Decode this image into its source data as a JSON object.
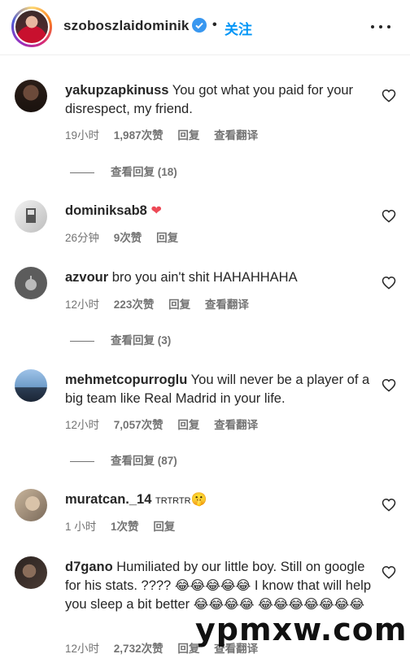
{
  "header": {
    "username": "szoboszlaidominik",
    "dot": "•",
    "follow_label": "关注"
  },
  "comments": [
    {
      "username": "yakupzapkinuss",
      "text": "You got what you paid for your disrespect, my friend.",
      "time": "19小时",
      "likes": "1,987次赞",
      "reply_label": "回复",
      "translate_label": "查看翻译",
      "view_replies": "查看回复 (18)"
    },
    {
      "username": "dominiksab8",
      "text": "",
      "emoji": "❤",
      "time": "26分钟",
      "likes": "9次赞",
      "reply_label": "回复"
    },
    {
      "username": "azvour",
      "text": "bro you ain't shit HAHAHHAHA",
      "time": "12小时",
      "likes": "223次赞",
      "reply_label": "回复",
      "translate_label": "查看翻译",
      "view_replies": "查看回复 (3)"
    },
    {
      "username": "mehmetcopurroglu",
      "text": "You will never be a player of a big team like Real Madrid in your life.",
      "time": "12小时",
      "likes": "7,057次赞",
      "reply_label": "回复",
      "translate_label": "查看翻译",
      "view_replies": "查看回复 (87)"
    },
    {
      "username": "muratcan._14",
      "text": "TRTRTR",
      "emoji": "🤫",
      "time": "1 小时",
      "likes": "1次赞",
      "reply_label": "回复"
    },
    {
      "username": "d7gano",
      "text": "Humiliated by our little boy. Still on google for his stats. ????",
      "emoji_row1": "😂😂😂😂😂",
      "text2": "I know that will help you sleep a bit better",
      "emoji_row2": "😂😂😂😂",
      "emoji_row3": "😂😂😂😂😂😂😂",
      "time": "12小时",
      "likes": "2,732次赞",
      "reply_label": "回复",
      "translate_label": "查看翻译"
    }
  ],
  "watermark": "ypmxw.com"
}
